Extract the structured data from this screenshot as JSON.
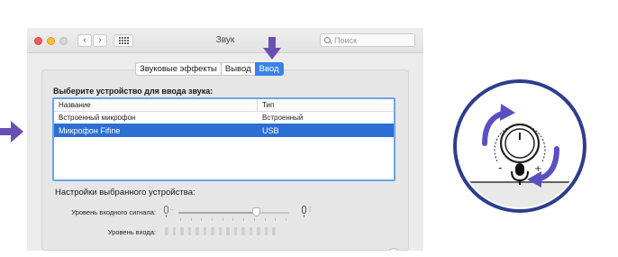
{
  "window": {
    "title": "Звук",
    "search_placeholder": "Поиск",
    "nav_back": "‹",
    "nav_forward": "›"
  },
  "tabs": [
    {
      "label": "Звуковые эффекты",
      "active": false
    },
    {
      "label": "Вывод",
      "active": false
    },
    {
      "label": "Ввод",
      "active": true
    }
  ],
  "input": {
    "section_title": "Выберите устройство для ввода звука:",
    "columns": [
      "Название",
      "Тип"
    ],
    "devices": [
      {
        "name": "Встроенный микрофон",
        "type": "Встроенный",
        "selected": false
      },
      {
        "name": "Микрофон Fifine",
        "type": "USB",
        "selected": true
      }
    ],
    "settings_title": "Настройки выбранного устройства:",
    "input_volume_label": "Уровень входного сигнала:",
    "input_volume_fraction": 0.7,
    "input_level_label": "Уровень входа:",
    "input_level_segments_lit": 0,
    "input_level_segments_total": 15,
    "help_label": "?"
  },
  "colors": {
    "accent_selected": "#2b6ed4",
    "tab_active": "#3a82e8",
    "instruction_arrow": "#6a4fb3",
    "illustration_circle": "#2e3d8f"
  },
  "icons": {
    "close": "red-traffic-light",
    "minimize": "yellow-traffic-light",
    "zoom": "green-traffic-light",
    "grid": "grid-icon",
    "search": "search-icon",
    "mic": "microphone-icon",
    "knob": "gain-knob-icon"
  },
  "illustration": {
    "minus_label": "-",
    "plus_label": "+"
  }
}
